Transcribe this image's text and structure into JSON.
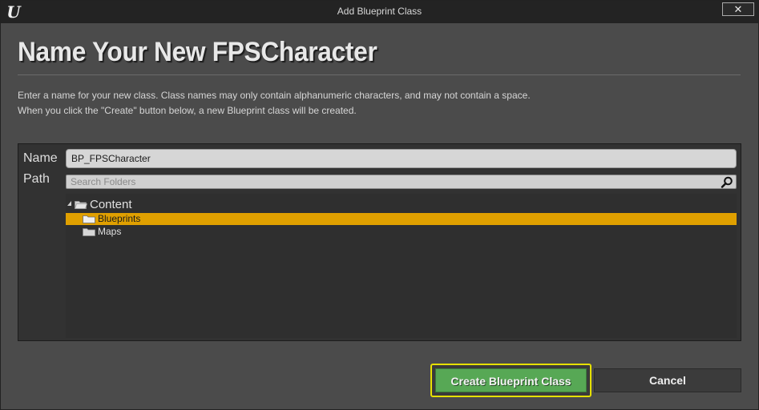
{
  "window": {
    "title": "Add Blueprint Class",
    "close_glyph": "✕",
    "logo_glyph": "U"
  },
  "heading": "Name Your New FPSCharacter",
  "description": {
    "line1": "Enter a name for your new class. Class names may only contain alphanumeric characters, and may not contain a space.",
    "line2": "When you click the \"Create\" button below, a new Blueprint class will be created."
  },
  "form": {
    "name_label": "Name",
    "name_value": "BP_FPSCharacter",
    "path_label": "Path",
    "search_placeholder": "Search Folders",
    "search_icon": "search-icon"
  },
  "tree": {
    "root": {
      "label": "Content",
      "icon": "folder-open-icon",
      "expanded": true
    },
    "children": [
      {
        "label": "Blueprints",
        "icon": "folder-icon",
        "selected": true
      },
      {
        "label": "Maps",
        "icon": "folder-icon",
        "selected": false
      }
    ]
  },
  "buttons": {
    "create_label": "Create Blueprint Class",
    "cancel_label": "Cancel"
  },
  "colors": {
    "selection": "#e0a000",
    "create_button": "#57a855",
    "focus_ring": "#e6e000",
    "panel_bg": "#323232",
    "window_bg": "#4b4b4b"
  }
}
